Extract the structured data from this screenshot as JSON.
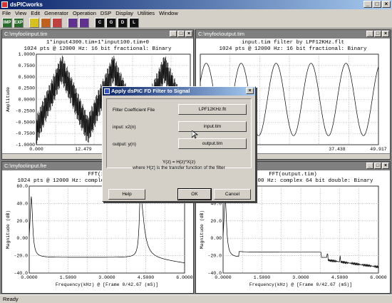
{
  "app": {
    "title": "dsPICworks"
  },
  "menu": [
    "File",
    "View",
    "Edit",
    "Generator",
    "Operation",
    "DSP",
    "Display",
    "Utilities",
    "Window"
  ],
  "toolbar": {
    "buttons": [
      {
        "name": "import-icon",
        "label": "IMP",
        "color": "#2a6a2a"
      },
      {
        "name": "export-icon",
        "label": "EXP",
        "color": "#2a6a2a"
      },
      {
        "name": "lightbulb-icon",
        "label": "",
        "color": "#d8c020"
      },
      {
        "name": "tool-icon",
        "label": "",
        "color": "#c06020"
      },
      {
        "name": "filter-icon",
        "label": "",
        "color": "#c04040"
      },
      {
        "name": "wave-icon",
        "label": "",
        "color": "#603090"
      },
      {
        "name": "wave2-icon",
        "label": "",
        "color": "#603090"
      },
      {
        "name": "c-icon",
        "label": "C",
        "color": "#101010"
      },
      {
        "name": "g-icon",
        "label": "G",
        "color": "#101010"
      },
      {
        "name": "d-icon",
        "label": "D",
        "color": "#101010"
      },
      {
        "name": "l-icon",
        "label": "L",
        "color": "#101010"
      }
    ]
  },
  "windows": {
    "w1": {
      "title": "C:\\myfoo\\input.tim",
      "line1": "1*input4300.tim+1*input100.tim+0",
      "line2": "1024 pts @ 12000 Hz: 16 bit fractional: Binary",
      "ylabel": "Amplitude",
      "yticks": [
        "1.0000",
        "0.7500",
        "0.5000",
        "0.2500",
        "0.0000",
        "-0.2500",
        "-0.5000",
        "-0.7500",
        "-1.0000"
      ],
      "xticks": [
        "0.000",
        "12.479"
      ],
      "xlabel": "Tim"
    },
    "w2": {
      "title": "C:\\myfoo\\output.tim",
      "line1": "input.tim filter by LPF12KHz.flt",
      "line2": "1024 pts @ 12000 Hz: 16 bit fractional: Binary",
      "xticks": [
        "12.479",
        "37.438",
        "49.917"
      ],
      "xlabel": "Time (mS)"
    },
    "w3": {
      "title": "C:\\myfoo\\input.fre",
      "line1": "FFT(ir",
      "line2": "1024 pts @ 12000 Hz: complex 64 bit double: Binary",
      "ylabel": "Magnitude (dB)",
      "yticks": [
        "60.0",
        "40.0",
        "20.0",
        "0.00",
        "-20.0",
        "-40.0"
      ],
      "xticks": [
        "0.0000",
        "1.5000",
        "3.0000",
        "4.5000",
        "6.0000"
      ],
      "xlabel": "Frequency(kHz) @ [Frame 0/42.67 (mS)]"
    },
    "w4": {
      "title": "",
      "line1": "FFT(output.tim)",
      "line2": "1024 pts @ 12000 Hz: complex 64 bit double: Binary",
      "ylabel": "Magnitude (dB)",
      "yticks": [
        "60.0",
        "40.0",
        "20.0",
        "0.00",
        "-20.0",
        "-40.0"
      ],
      "xticks": [
        "0.0000",
        "1.5000",
        "3.0000",
        "4.5000",
        "6.0000"
      ],
      "xlabel": "Frequency(kHz) @ [Frame 0/42.67 (mS)]"
    }
  },
  "dialog": {
    "title": "Apply dsPIC FD Filter to Signal",
    "coef_label": "Filter Coefficient File",
    "coef_value": "LPF12KHz.flt",
    "input_label": "input:  x2(n)",
    "input_value": "input.tim",
    "output_label": "output:  y(n)",
    "output_value": "output.tim",
    "formula1": "Y(z) = H(z)*X(z)",
    "formula2": "where H(z) is the transfer function of the filter",
    "help": "Help",
    "ok": "OK",
    "cancel": "Cancel"
  },
  "status": "Ready"
}
